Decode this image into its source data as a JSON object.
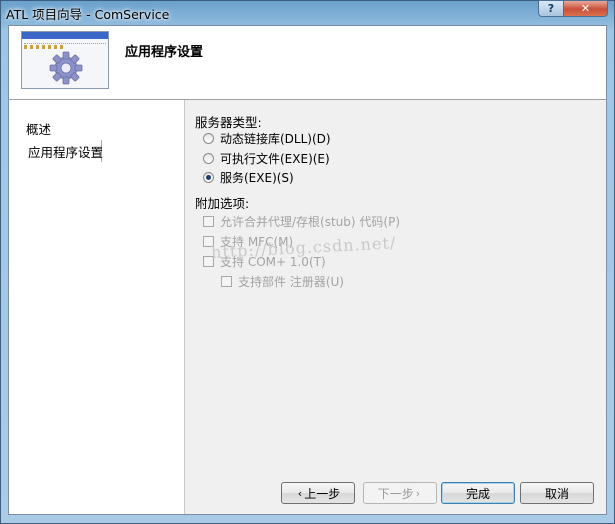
{
  "window": {
    "title": "ATL 项目向导 - ComService"
  },
  "header": {
    "title": "应用程序设置"
  },
  "nav": {
    "items": [
      "概述",
      "应用程序设置"
    ]
  },
  "server_type": {
    "label": "服务器类型:",
    "options": [
      {
        "label": "动态链接库(DLL)(D)",
        "checked": false
      },
      {
        "label": "可执行文件(EXE)(E)",
        "checked": false
      },
      {
        "label": "服务(EXE)(S)",
        "checked": true
      }
    ]
  },
  "additional": {
    "label": "附加选项:",
    "options": [
      {
        "label": "允许合并代理/存根(stub) 代码(P)",
        "checked": false,
        "enabled": false
      },
      {
        "label": "支持 MFC(M)",
        "checked": false,
        "enabled": false
      },
      {
        "label": "支持 COM+ 1.0(T)",
        "checked": false,
        "enabled": false
      },
      {
        "label": "支持部件 注册器(U)",
        "checked": false,
        "enabled": false
      }
    ]
  },
  "watermark": "http://blog.csdn.net/",
  "buttons": {
    "prev": "上一步",
    "next": "下一步",
    "finish": "完成",
    "cancel": "取消"
  },
  "colors": {
    "accent": "#3a67c8",
    "disabled_text": "#a3a3a3"
  }
}
